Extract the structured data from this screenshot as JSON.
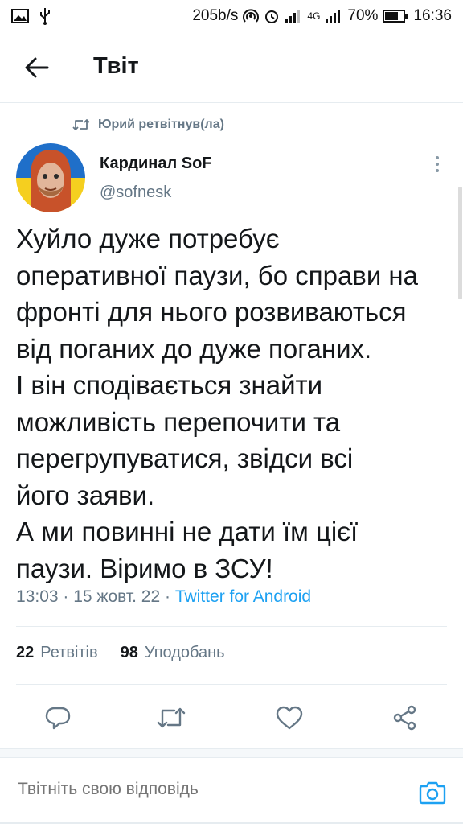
{
  "status_bar": {
    "speed": "205b/s",
    "network": "4G",
    "battery": "70%",
    "time": "16:36"
  },
  "header": {
    "title": "Твіт"
  },
  "retweet": {
    "text": "Юрий ретвітнув(ла)"
  },
  "author": {
    "name": "Кардинал SoF",
    "handle": "@sofnesk"
  },
  "tweet": {
    "lines": [
      "Хуйло дуже потребує",
      "оперативної паузи, бо справи на",
      "фронті для нього розвиваються",
      "від поганих до дуже поганих.",
      "І він сподівається знайти",
      "можливість перепочити та",
      "перегрупуватися, звідси всі",
      "його заяви.",
      "А ми повинні не дати їм цієї",
      "паузи. Віримо в ЗСУ!"
    ],
    "time": "13:03",
    "date": "15 жовт. 22",
    "source": "Twitter for Android"
  },
  "stats": {
    "retweets_count": "22",
    "retweets_label": "Ретвітів",
    "likes_count": "98",
    "likes_label": "Уподобань"
  },
  "reply": {
    "placeholder": "Твітніть свою відповідь"
  },
  "colors": {
    "accent": "#1da1f2",
    "secondary_text": "#657786",
    "primary_text": "#14171a"
  }
}
